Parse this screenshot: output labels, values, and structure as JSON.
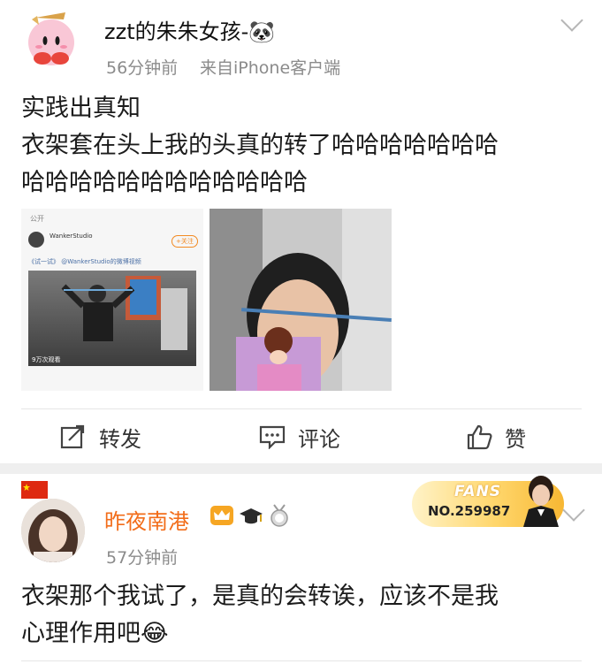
{
  "post1": {
    "username": "zzt的朱朱女孩-🐼",
    "time": "56分钟前",
    "source": "来自iPhone客户端",
    "text_lines": [
      "实践出真知",
      "衣架套在头上我的头真的转了哈哈哈哈哈哈哈",
      "哈哈哈哈哈哈哈哈哈哈哈哈"
    ],
    "embedded": {
      "public_label": "公开",
      "author": "WankerStudio",
      "follow_label": "+关注",
      "caption": "《试一试》 @WankerStudio的微博视频",
      "view_count": "9万次观看"
    },
    "actions": {
      "repost": "转发",
      "comment": "评论",
      "like": "赞"
    }
  },
  "post2": {
    "username": "昨夜南港",
    "time": "57分钟前",
    "text_lines": [
      "衣架那个我试了，是真的会转诶，应该不是我",
      "心理作用吧😂"
    ],
    "fans_badge": {
      "label": "FANS",
      "number": "NO.259987"
    }
  },
  "colors": {
    "username_orange": "#f26d1a",
    "meta_gray": "#8b8b8b",
    "separator": "#efefef"
  }
}
